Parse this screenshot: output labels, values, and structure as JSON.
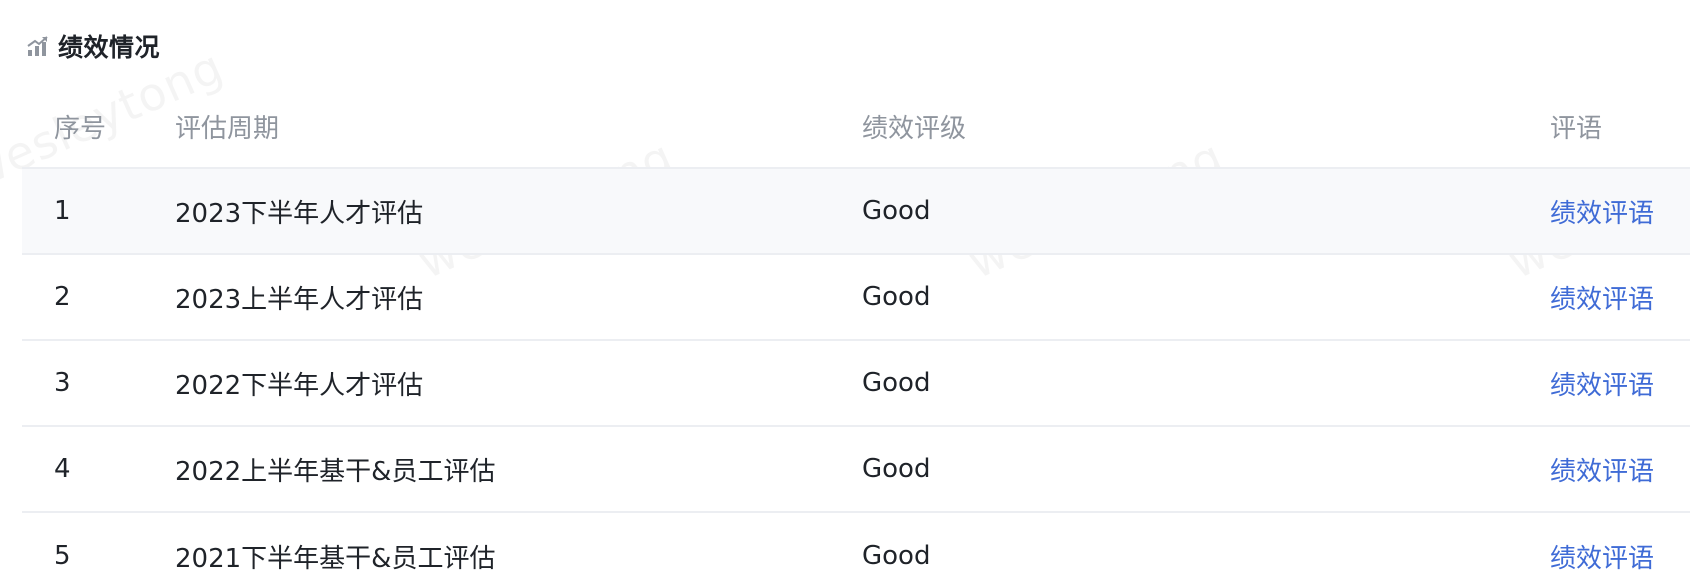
{
  "section": {
    "title": "绩效情况",
    "icon": "trend-chart-icon"
  },
  "watermark": "wesleytong",
  "table": {
    "columns": [
      "序号",
      "评估周期",
      "绩效评级",
      "评语"
    ],
    "rows": [
      {
        "index": "1",
        "period": "2023下半年人才评估",
        "grade": "Good",
        "comment": "绩效评语"
      },
      {
        "index": "2",
        "period": "2023上半年人才评估",
        "grade": "Good",
        "comment": "绩效评语"
      },
      {
        "index": "3",
        "period": "2022下半年人才评估",
        "grade": "Good",
        "comment": "绩效评语"
      },
      {
        "index": "4",
        "period": "2022上半年基干&员工评估",
        "grade": "Good",
        "comment": "绩效评语"
      },
      {
        "index": "5",
        "period": "2021下半年基干&员工评估",
        "grade": "Good",
        "comment": "绩效评语"
      }
    ]
  },
  "colors": {
    "link": "#3f6bd6",
    "header_text": "#8f959e",
    "body_text": "#1f2329",
    "row_highlight": "#f8f9fb",
    "divider": "#eceef2"
  }
}
